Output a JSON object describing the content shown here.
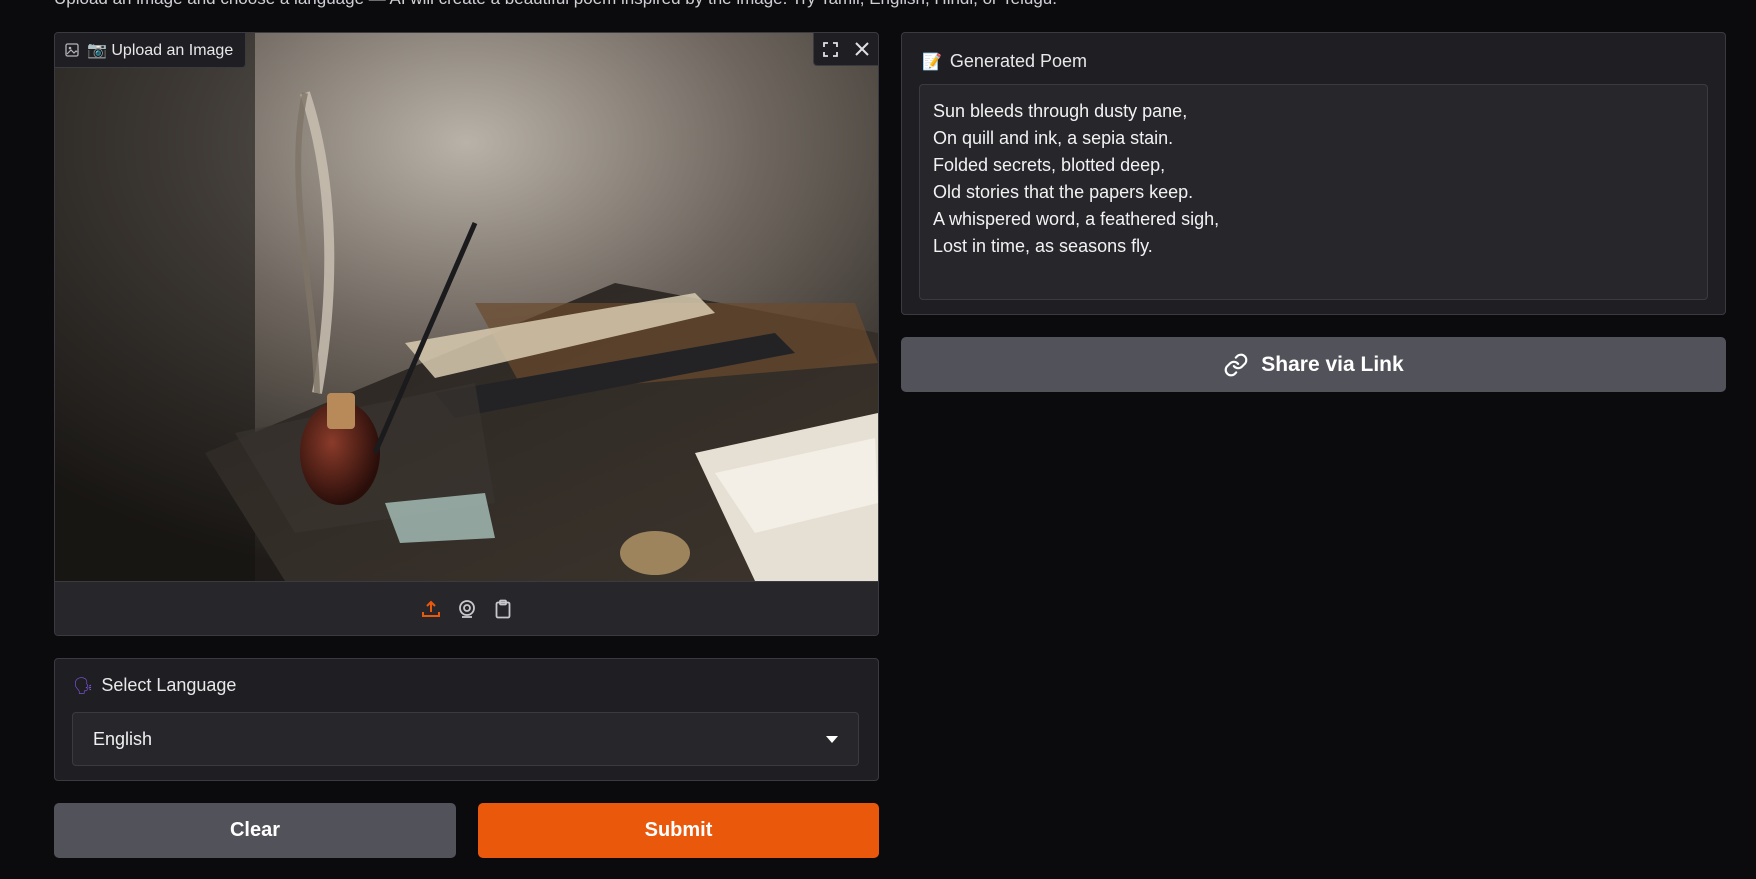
{
  "intro_text": "Upload an image and choose a language — AI will create a beautiful poem inspired by the image. Try Tamil, English, Hindi, or Telugu.",
  "image_panel": {
    "label": "📷 Upload an Image",
    "tools": [
      "fullscreen-icon",
      "close-icon"
    ],
    "sources": [
      "upload-icon",
      "webcam-icon",
      "clipboard-icon"
    ]
  },
  "language": {
    "label": "Select Language",
    "emoji": "🗣",
    "selected": "English"
  },
  "buttons": {
    "clear": "Clear",
    "submit": "Submit",
    "share": "Share via Link"
  },
  "poem": {
    "label": "Generated Poem",
    "emoji": "📝",
    "text": "Sun bleeds through dusty pane,\nOn quill and ink, a sepia stain.\nFolded secrets, blotted deep,\nOld stories that the papers keep.\nA whispered word, a feathered sigh,\nLost in time, as seasons fly."
  },
  "colors": {
    "accent": "#ea580c",
    "panel": "#1f1f23",
    "background": "#0b0b0d",
    "secondary_button": "#52525b"
  }
}
